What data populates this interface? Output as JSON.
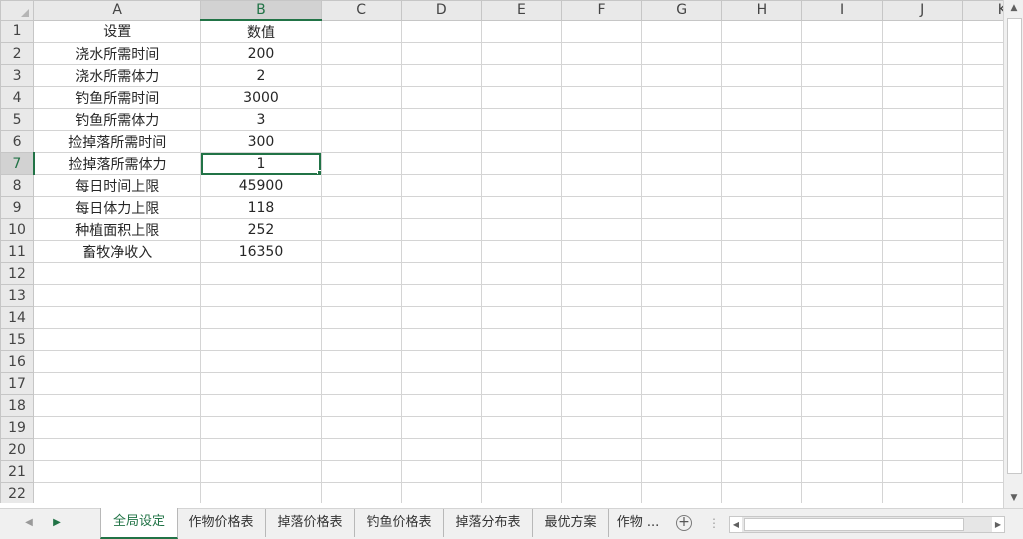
{
  "sheet": {
    "columns": [
      "A",
      "B",
      "C",
      "D",
      "E",
      "F",
      "G",
      "H",
      "I",
      "J",
      "K"
    ],
    "rows": [
      {
        "num": "1",
        "a": "设置",
        "b": "数值"
      },
      {
        "num": "2",
        "a": "浇水所需时间",
        "b": "200"
      },
      {
        "num": "3",
        "a": "浇水所需体力",
        "b": "2"
      },
      {
        "num": "4",
        "a": "钓鱼所需时间",
        "b": "3000"
      },
      {
        "num": "5",
        "a": "钓鱼所需体力",
        "b": "3"
      },
      {
        "num": "6",
        "a": "捡掉落所需时间",
        "b": "300"
      },
      {
        "num": "7",
        "a": "捡掉落所需体力",
        "b": "1"
      },
      {
        "num": "8",
        "a": "每日时间上限",
        "b": "45900"
      },
      {
        "num": "9",
        "a": "每日体力上限",
        "b": "118"
      },
      {
        "num": "10",
        "a": "种植面积上限",
        "b": "252"
      },
      {
        "num": "11",
        "a": "畜牧净收入",
        "b": "16350"
      },
      {
        "num": "12",
        "a": "",
        "b": ""
      },
      {
        "num": "13",
        "a": "",
        "b": ""
      },
      {
        "num": "14",
        "a": "",
        "b": ""
      },
      {
        "num": "15",
        "a": "",
        "b": ""
      },
      {
        "num": "16",
        "a": "",
        "b": ""
      },
      {
        "num": "17",
        "a": "",
        "b": ""
      },
      {
        "num": "18",
        "a": "",
        "b": ""
      },
      {
        "num": "19",
        "a": "",
        "b": ""
      },
      {
        "num": "20",
        "a": "",
        "b": ""
      },
      {
        "num": "21",
        "a": "",
        "b": ""
      },
      {
        "num": "22",
        "a": "",
        "b": ""
      }
    ],
    "selected_cell": "B7"
  },
  "tabs": {
    "items": [
      "全局设定",
      "作物价格表",
      "掉落价格表",
      "钓鱼价格表",
      "掉落分布表",
      "最优方案",
      "作物 ..."
    ],
    "active_index": 0
  },
  "colors": {
    "accent": "#217346",
    "header_bg": "#e9e9e9",
    "gridline": "#d4d4d4"
  }
}
